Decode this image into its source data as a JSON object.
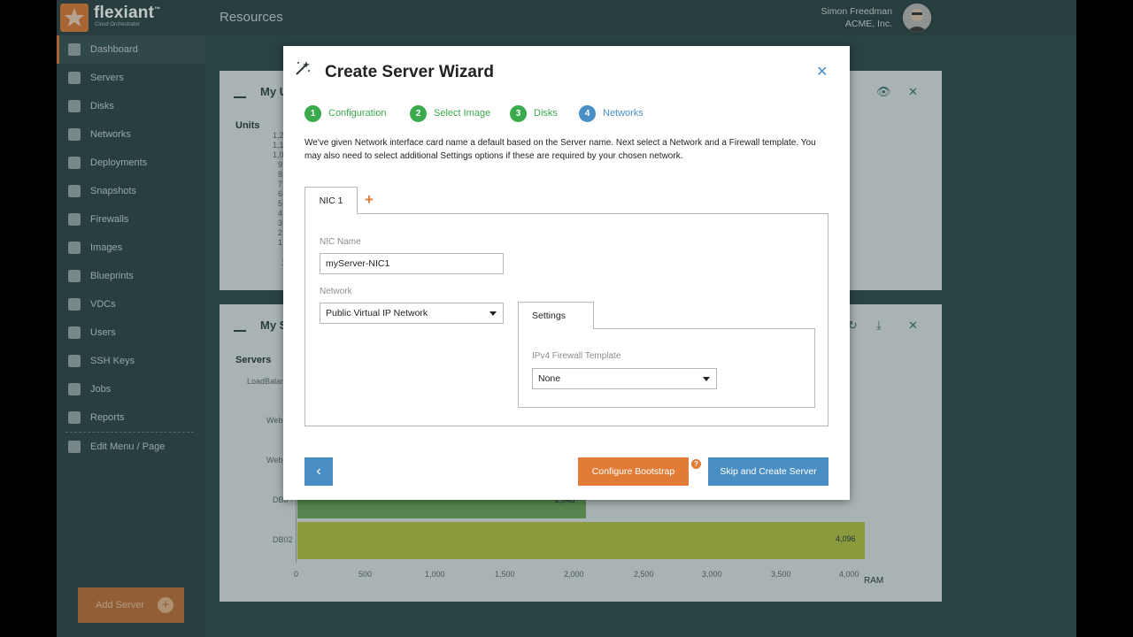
{
  "brand": {
    "name": "flexiant",
    "trademark": "™",
    "subtitle": "Cloud Orchestrator",
    "accent": "#e07c36"
  },
  "header": {
    "title": "Resources",
    "user_name": "Simon Freedman",
    "user_org": "ACME, Inc."
  },
  "sidebar": {
    "items": [
      {
        "label": "Dashboard",
        "icon": "dashboard-icon",
        "active": true
      },
      {
        "label": "Servers",
        "icon": "server-icon"
      },
      {
        "label": "Disks",
        "icon": "disk-icon"
      },
      {
        "label": "Networks",
        "icon": "network-icon"
      },
      {
        "label": "Deployments",
        "icon": "deployment-icon"
      },
      {
        "label": "Snapshots",
        "icon": "camera-icon"
      },
      {
        "label": "Firewalls",
        "icon": "flame-icon"
      },
      {
        "label": "Images",
        "icon": "image-icon"
      },
      {
        "label": "Blueprints",
        "icon": "blueprint-icon"
      },
      {
        "label": "VDCs",
        "icon": "cloud-icon"
      },
      {
        "label": "Users",
        "icon": "user-icon"
      },
      {
        "label": "SSH Keys",
        "icon": "key-icon"
      },
      {
        "label": "Jobs",
        "icon": "clipboard-icon"
      },
      {
        "label": "Reports",
        "icon": "chart-icon"
      },
      {
        "label": "Edit Menu / Page",
        "icon": "pencil-icon"
      }
    ],
    "add_server_label": "Add Server"
  },
  "background": {
    "panel1": {
      "title": "My U",
      "units_label": "Units",
      "yticks": [
        "1,2",
        "1,1",
        "1,0",
        "9",
        "8",
        "7",
        "6",
        "5",
        "4",
        "3",
        "2",
        "1",
        "1"
      ]
    },
    "panel2": {
      "title": "My S",
      "servers_label": "Servers",
      "rows": [
        "LoadBalan",
        "Web",
        "Web",
        "DB0",
        "DB02"
      ],
      "db01_value": "2,048",
      "db02_value": "4,096",
      "x_ticks": [
        "0",
        "500",
        "1,000",
        "1,500",
        "2,000",
        "2,500",
        "3,000",
        "3,500",
        "4,000"
      ],
      "x_label": "RAM"
    }
  },
  "wizard": {
    "title": "Create Server Wizard",
    "steps": [
      {
        "num": "1",
        "label": "Configuration",
        "state": "done"
      },
      {
        "num": "2",
        "label": "Select Image",
        "state": "done"
      },
      {
        "num": "3",
        "label": "Disks",
        "state": "done"
      },
      {
        "num": "4",
        "label": "Networks",
        "state": "current"
      }
    ],
    "intro": "We've given Network interface card name a default based on the Server name. Next select a Network and a Firewall template. You may also need to select additional Settings options if these are required by your chosen network.",
    "nic_tab": "NIC 1",
    "nic_name_label": "NIC Name",
    "nic_name_value": "myServer-NIC1",
    "network_label": "Network",
    "network_value": "Public Virtual IP Network",
    "settings_tab": "Settings",
    "firewall_label": "IPv4 Firewall Template",
    "firewall_value": "None",
    "configure_bootstrap": "Configure Bootstrap",
    "help_badge": "?",
    "skip_create": "Skip and Create Server",
    "colors": {
      "green": "#3aaa4d",
      "blue": "#4a8fc4",
      "orange": "#e07c36"
    }
  }
}
